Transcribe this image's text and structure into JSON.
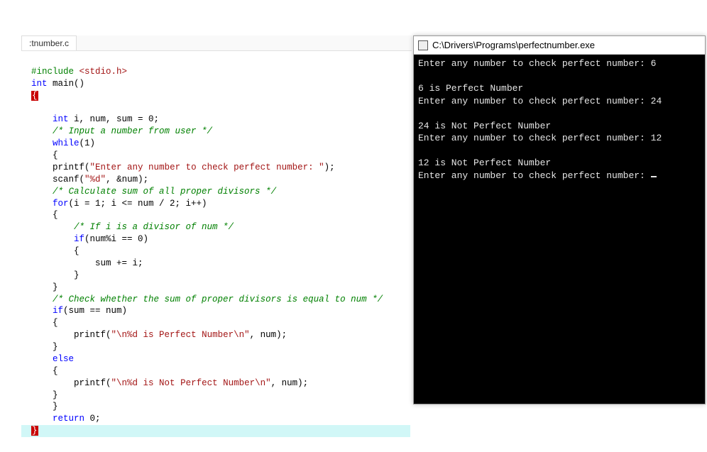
{
  "editor": {
    "tab_label": ":tnumber.c",
    "code": {
      "l1_pre": "#include",
      "l1_inc": " <stdio.h>",
      "l2_kw1": "int",
      "l2_fn": " main",
      "l2_rest": "()",
      "l3_brace": "{",
      "l5_kw": "int",
      "l5_rest": " i, num, sum = 0;",
      "l6_cmt": "/* Input a number from user */",
      "l7_kw": "while",
      "l7_rest": "(1)",
      "l8_brace": "{",
      "l9_fn": "printf",
      "l9_open": "(",
      "l9_str": "\"Enter any number to check perfect number: \"",
      "l9_close": ");",
      "l10_fn": "scanf",
      "l10_open": "(",
      "l10_str": "\"%d\"",
      "l10_rest": ", &num);",
      "l11_cmt": "/* Calculate sum of all proper divisors */",
      "l12_kw": "for",
      "l12_rest": "(i = 1; i <= num / 2; i++)",
      "l13_brace": "{",
      "l14_cmt": "/* If i is a divisor of num */",
      "l15_kw": "if",
      "l15_rest": "(num%i == 0)",
      "l16_brace": "{",
      "l17": "sum += i;",
      "l18_brace": "}",
      "l19_brace": "}",
      "l20_cmt": "/* Check whether the sum of proper divisors is equal to num */",
      "l21_kw": "if",
      "l21_rest": "(sum == num)",
      "l22_brace": "{",
      "l23_fn": "printf",
      "l23_open": "(",
      "l23_str": "\"\\n%d is Perfect Number\\n\"",
      "l23_rest": ", num);",
      "l24_brace": "}",
      "l25_kw": "else",
      "l26_brace": "{",
      "l27_fn": "printf",
      "l27_open": "(",
      "l27_str": "\"\\n%d is Not Perfect Number\\n\"",
      "l27_rest": ", num);",
      "l28_brace": "}",
      "l29_brace": "}",
      "l30_kw": "return",
      "l30_rest": " 0;",
      "l31_brace": "}"
    }
  },
  "console": {
    "title": "C:\\Drivers\\Programs\\perfectnumber.exe",
    "lines": [
      "Enter any number to check perfect number: 6",
      "",
      "6 is Perfect Number",
      "Enter any number to check perfect number: 24",
      "",
      "24 is Not Perfect Number",
      "Enter any number to check perfect number: 12",
      "",
      "12 is Not Perfect Number",
      "Enter any number to check perfect number: "
    ]
  }
}
